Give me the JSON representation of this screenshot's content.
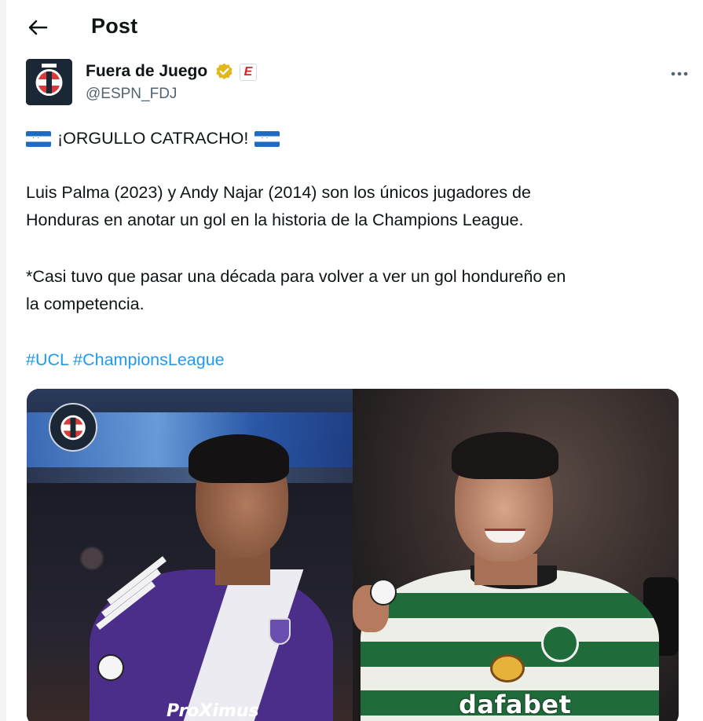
{
  "header": {
    "title": "Post",
    "back_icon": "arrow-left-icon"
  },
  "author": {
    "name": "Fuera de Juego",
    "handle": "@ESPN_FDJ",
    "verified_color": "#e2b719",
    "affiliate_badge": "E",
    "more_icon": "more-horizontal-icon"
  },
  "tweet": {
    "headline": "¡ORGULLO CATRACHO!",
    "paragraph1_line1": "Luis Palma (2023) y Andy Najar (2014) son los únicos jugadores de",
    "paragraph1_line2": "Honduras en anotar un gol en la historia de la Champions League.",
    "paragraph2_line1": "*Casi tuvo que pasar una década para volver a ver un gol hondureño en",
    "paragraph2_line2": "la competencia.",
    "hashtags": [
      "#UCL",
      "#ChampionsLeague"
    ]
  },
  "media": {
    "left_sponsor_text": "ProXimus",
    "right_sponsor_text": "dafabet",
    "flag_icon": "honduras-flag-icon"
  },
  "colors": {
    "accent": "#1d9bf0",
    "text": "#0f1419",
    "muted": "#536471"
  }
}
